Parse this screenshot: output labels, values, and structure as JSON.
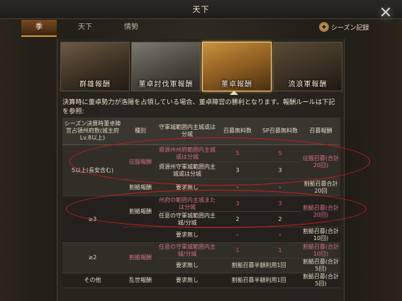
{
  "header": {
    "title": "天下"
  },
  "tabs": [
    {
      "label": "季"
    },
    {
      "label": "天下"
    },
    {
      "label": "情勢"
    }
  ],
  "season_button": {
    "label": "シーズン記録"
  },
  "banners": [
    {
      "label": "群雄報酬"
    },
    {
      "label": "董卓討伐軍報酬"
    },
    {
      "label": "董卓報酬"
    },
    {
      "label": "流浪軍報酬"
    }
  ],
  "description": "決算時に董卓勢力が洛陽を占領している場合、董卓陣営の勝利となります。報酬ルールは下記を参照:",
  "table": {
    "headers": [
      "シーズン決算時董卓陣営占領州府数(城主府Lv.8以上)",
      "種別",
      "守軍城範囲内主城或は分城",
      "召募無料数",
      "SP召募無料数",
      "召募報酬"
    ],
    "rows": {
      "r1": {
        "count": "5以上(長安含む)",
        "type": "征服報酬",
        "req": "資源州州府範囲内主城或は分城",
        "free": "5",
        "sp": "5",
        "reward": "征服召募(合計20回)"
      },
      "r2": {
        "req": "資源州守軍城範囲内主城或は分城",
        "free": "3",
        "sp": "3"
      },
      "r3": {
        "type": "割拠報酬",
        "req": "要求無し",
        "free": "-",
        "sp": "-",
        "reward": "割拠召募合計20回"
      },
      "r4": {
        "count": "≥3",
        "type": "割拠報酬",
        "req": "州府の範囲内主城または分城",
        "free": "3",
        "sp": "3",
        "reward": "割拠召募(合計20回)"
      },
      "r5": {
        "req": "任意の守軍城範囲内主城/分城",
        "free": "2",
        "sp": "2"
      },
      "r6": {
        "req": "要求無し",
        "free": "-",
        "sp": "-",
        "reward": "割拠召募(合計10回)"
      },
      "r7": {
        "count": "≥2",
        "type": "割拠報酬",
        "req": "任意の守軍城範囲内主城/分城",
        "free": "1",
        "sp": "1",
        "reward": "割拠召募(合計10回)"
      },
      "r8": {
        "req": "要求無し",
        "merged": "割拠召募半額利用1回",
        "reward": "割拠召募(合計5回)"
      },
      "r9": {
        "count": "その他",
        "type": "乱世報酬",
        "req": "要求無し",
        "merged": "割拠召募半額利用1回",
        "reward": "割拠召募(合計5回)"
      }
    }
  },
  "colors": {
    "accent": "#d99a3a",
    "highlight_red": "#e05a5a",
    "annotation": "#d81a1a"
  }
}
